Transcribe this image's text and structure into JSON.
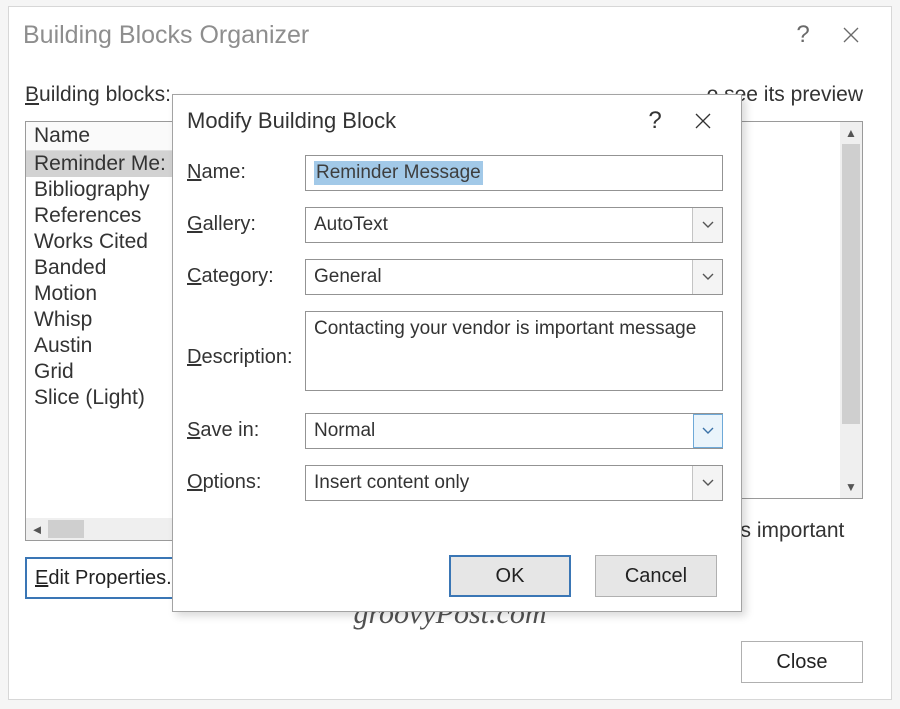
{
  "parent": {
    "title": "Building Blocks Organizer",
    "bb_label": "Building blocks:",
    "preview_label": "o see its preview",
    "list_header": "Name",
    "items": [
      "Reminder Me:",
      "Bibliography",
      "References",
      "Works Cited",
      "Banded",
      "Motion",
      "Whisp",
      "Austin",
      "Grid",
      "Slice (Light)"
    ],
    "edit_props": "Edit Properties.",
    "preview_desc": "r is important",
    "close": "Close",
    "watermark": "groovyPost.com"
  },
  "modal": {
    "title": "Modify Building Block",
    "labels": {
      "name": "Name:",
      "gallery": "Gallery:",
      "category": "Category:",
      "description": "Description:",
      "savein": "Save in:",
      "options": "Options:"
    },
    "values": {
      "name": "Reminder Message",
      "gallery": "AutoText",
      "category": "General",
      "description": "Contacting your vendor is important message",
      "savein": "Normal",
      "options": "Insert content only"
    },
    "ok": "OK",
    "cancel": "Cancel"
  }
}
